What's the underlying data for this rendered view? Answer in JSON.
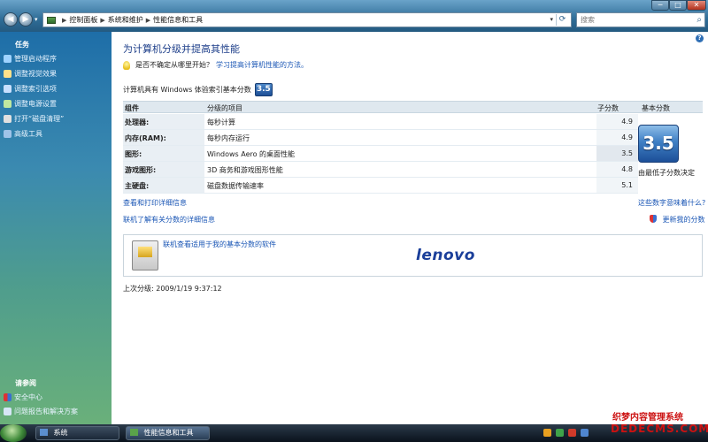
{
  "window": {
    "min": "─",
    "max": "□",
    "close": "✕"
  },
  "address": {
    "crumbs": [
      "控制面板",
      "系统和维护",
      "性能信息和工具"
    ],
    "search_placeholder": "搜索"
  },
  "sidebar": {
    "tasks_title": "任务",
    "tasks": [
      "管理启动程序",
      "调整视觉效果",
      "调整索引选项",
      "调整电源设置",
      "打开“磁盘清理”",
      "高级工具"
    ],
    "see_also_title": "请参阅",
    "see_also": [
      "安全中心",
      "问题报告和解决方案"
    ]
  },
  "main": {
    "title": "为计算机分级并提高其性能",
    "hint_text": "是否不确定从哪里开始？",
    "hint_link": "学习提高计算机性能的方法。",
    "base_label": "计算机具有 Windows 体验索引基本分数",
    "base_score": "3.5",
    "table": {
      "headers": [
        "组件",
        "分级的项目",
        "子分数",
        "基本分数"
      ],
      "rows": [
        {
          "component": "处理器:",
          "item": "每秒计算",
          "subscore": "4.9"
        },
        {
          "component": "内存(RAM):",
          "item": "每秒内存运行",
          "subscore": "4.9"
        },
        {
          "component": "图形:",
          "item": "Windows Aero 的桌面性能",
          "subscore": "3.5"
        },
        {
          "component": "游戏图形:",
          "item": "3D 商务和游戏图形性能",
          "subscore": "4.8"
        },
        {
          "component": "主硬盘:",
          "item": "磁盘数据传输速率",
          "subscore": "5.1"
        }
      ]
    },
    "big_score": "3.5",
    "score_caption": "由最低子分数决定",
    "link_print": "查看和打印详细信息",
    "link_meaning": "这些数字意味着什么?",
    "link_online": "联机了解有关分数的详细信息",
    "link_update": "更新我的分数",
    "software_link": "联机查看适用于我的基本分数的软件",
    "brand": "lenovo",
    "last_rated": "上次分级: 2009/1/19 9:37:12"
  },
  "taskbar": {
    "start_window": "系统",
    "active_window": "性能信息和工具"
  },
  "watermark": {
    "line1": "织梦内容管理系统",
    "line2": "DEDECMS.COM"
  },
  "colors": {
    "title": "#1e3f8a",
    "link": "#1a56b5",
    "badge": "#2a5fa8"
  }
}
